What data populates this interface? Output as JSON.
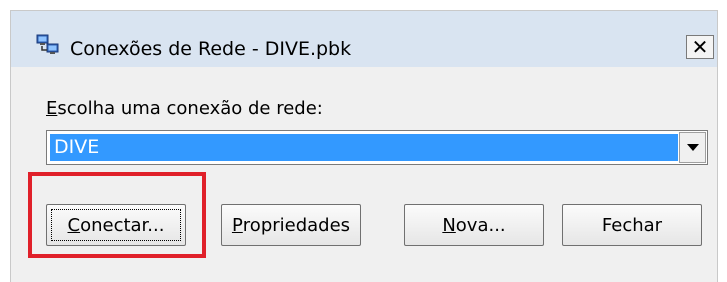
{
  "window": {
    "title": "Conexões de Rede - DIVE.pbk",
    "icon": "network-connection-icon",
    "close_label": "✕"
  },
  "connection": {
    "label_accel": "E",
    "label_rest": "scolha uma conexão de rede:",
    "selected": "DIVE"
  },
  "buttons": {
    "connect": {
      "accel": "C",
      "rest": "onectar..."
    },
    "properties": {
      "accel": "P",
      "rest": "ropriedades"
    },
    "new": {
      "accel": "N",
      "rest": "ova..."
    },
    "close": {
      "label": "Fechar"
    }
  },
  "colors": {
    "selection": "#3399ff",
    "highlight": "#e0202a"
  }
}
